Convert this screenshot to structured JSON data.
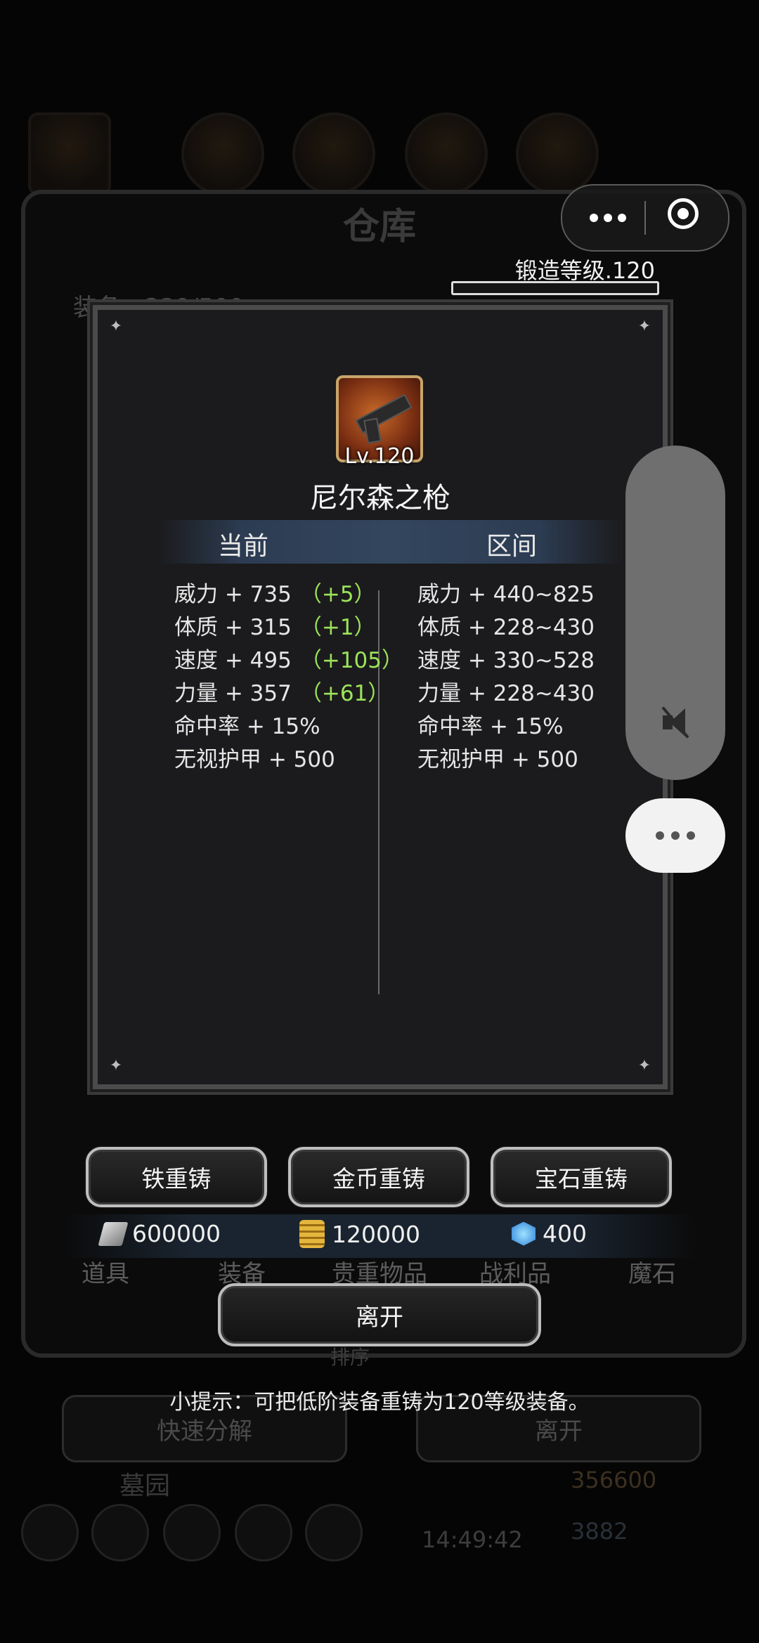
{
  "background": {
    "title": "仓库",
    "equip_count": "装备：239/500",
    "tabs": [
      "道具",
      "装备",
      "贵重物品",
      "战利品",
      "魔石"
    ],
    "sort_label": "排序",
    "quick_decompose": "快速分解",
    "leave": "离开",
    "graveyard": "墓园",
    "clock": "14:49:42",
    "gold": "356600",
    "gems": "3882"
  },
  "capsule": {
    "more_icon": "more-dots-icon",
    "close_icon": "target-ring-icon"
  },
  "forge": {
    "level_label": "锻造等级.120"
  },
  "item": {
    "icon": "pistol-icon",
    "level": "Lv.120",
    "name": "尼尔森之枪"
  },
  "columns": {
    "current": "当前",
    "range": "区间"
  },
  "current_stats": [
    {
      "text": "威力 + 735",
      "bonus": "（+5）"
    },
    {
      "text": "体质 + 315",
      "bonus": "（+1）"
    },
    {
      "text": "速度 + 495",
      "bonus": "（+105）"
    },
    {
      "text": "力量 + 357",
      "bonus": "（+61）"
    },
    {
      "text": "命中率 + 15%",
      "bonus": ""
    },
    {
      "text": "无视护甲 + 500",
      "bonus": ""
    }
  ],
  "range_stats": [
    "威力 + 440~825",
    "体质 + 228~430",
    "速度 + 330~528",
    "力量 + 228~430",
    "命中率 + 15%",
    "无视护甲 + 500"
  ],
  "buttons": {
    "iron_reforge": "铁重铸",
    "gold_reforge": "金币重铸",
    "gem_reforge": "宝石重铸",
    "leave": "离开"
  },
  "currency": {
    "iron": "600000",
    "gold": "120000",
    "gem": "400"
  },
  "tip": "小提示：可把低阶装备重铸为120等级装备。",
  "colors": {
    "bonus": "#9be35a",
    "accent_band": "#33465e"
  }
}
